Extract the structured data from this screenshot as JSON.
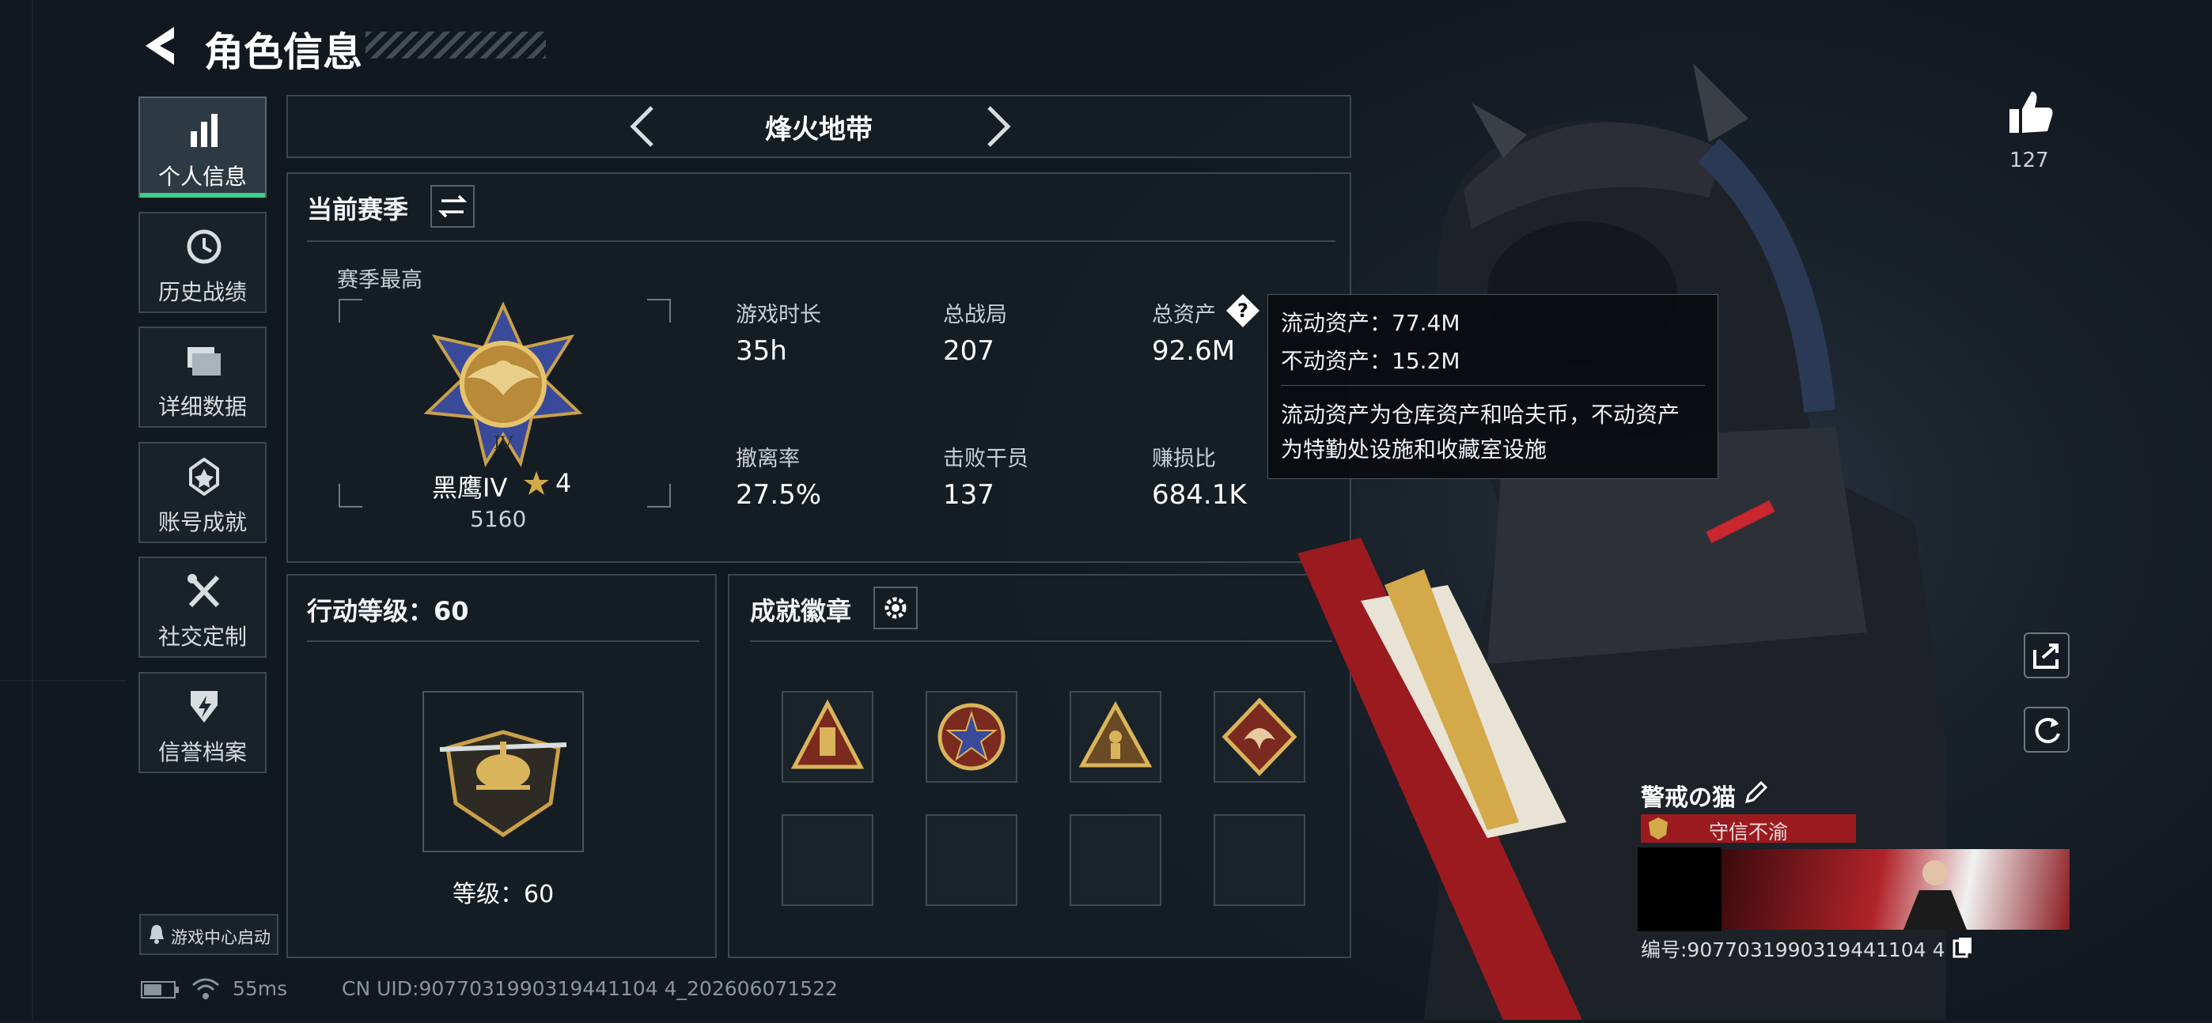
{
  "header": {
    "title": "角色信息"
  },
  "sidebar": {
    "items": [
      {
        "label": "个人信息",
        "icon": "bar-chart-icon"
      },
      {
        "label": "历史战绩",
        "icon": "history-icon"
      },
      {
        "label": "详细数据",
        "icon": "folder-icon"
      },
      {
        "label": "账号成就",
        "icon": "achievement-icon"
      },
      {
        "label": "社交定制",
        "icon": "tools-icon"
      },
      {
        "label": "信誉档案",
        "icon": "shield-icon"
      }
    ],
    "active": "个人信息",
    "game_center": "游戏中心启动"
  },
  "mode": {
    "name": "烽火地带"
  },
  "season": {
    "title": "当前赛季",
    "best_label": "赛季最高",
    "rank_name": "黑鹰IV",
    "rank_stars": "4",
    "rank_score": "5160",
    "stats": [
      {
        "label": "游戏时长",
        "value": "35h"
      },
      {
        "label": "总战局",
        "value": "207"
      },
      {
        "label": "总资产",
        "value": "92.6M"
      },
      {
        "label": "撤离率",
        "value": "27.5%"
      },
      {
        "label": "击败干员",
        "value": "137"
      },
      {
        "label": "赚损比",
        "value": "684.1K"
      }
    ]
  },
  "tooltip": {
    "liquid": "流动资产：77.4M",
    "fixed": "不动资产：15.2M",
    "desc1": "流动资产为仓库资产和哈夫币，不动资产",
    "desc2": "为特勤处设施和收藏室设施"
  },
  "action_level": {
    "title": "行动等级：60",
    "level_text": "等级：60"
  },
  "badges": {
    "title": "成就徽章"
  },
  "profile": {
    "likes": "127",
    "name": "警戒の猫",
    "tag": "守信不渝",
    "id_text": "编号:9077031990319441104 4"
  },
  "status": {
    "ping": "55ms",
    "uid": "CN UID:9077031990319441104 4_202606071522"
  },
  "colors": {
    "accent": "#3ecf8e",
    "tag_red": "#9b1a1f",
    "gold": "#d3a94a"
  }
}
